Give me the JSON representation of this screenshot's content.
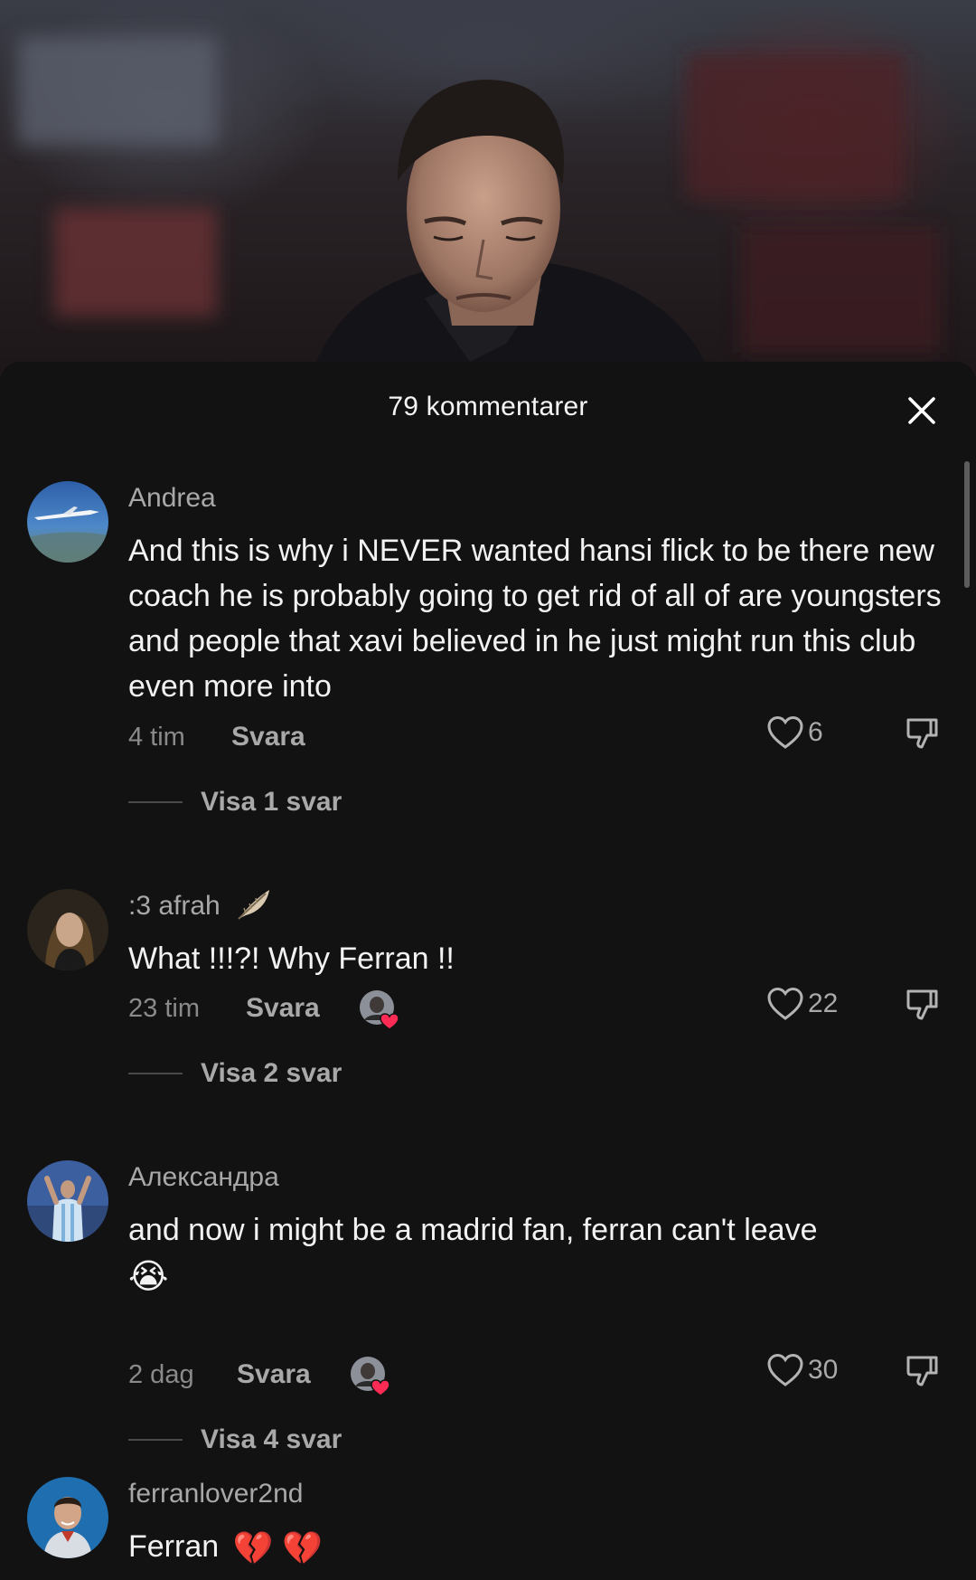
{
  "header": {
    "title": "79 kommentarer",
    "close_icon": "close-icon"
  },
  "comments": [
    {
      "username": "Andrea",
      "text": "And this is why i NEVER wanted hansi flick to be there new coach he is probably going to get rid of all of are youngsters and people that xavi believed in he just might run this club even more into",
      "time": "4 tim",
      "reply_label": "Svara",
      "likes": "6",
      "view_replies": "Visa 1 svar",
      "creator_liked": false
    },
    {
      "username": ":3 afrah",
      "username_emoji": "feather",
      "text": "What !!!?! Why Ferran !!",
      "time": "23 tim",
      "reply_label": "Svara",
      "likes": "22",
      "view_replies": "Visa 2 svar",
      "creator_liked": true
    },
    {
      "username": "Александра",
      "text": "and now i might be a madrid fan, ferran can't leave",
      "text_emoji": "😭",
      "time": "2 dag",
      "reply_label": "Svara",
      "likes": "30",
      "view_replies": "Visa 4 svar",
      "creator_liked": true
    },
    {
      "username": "ferranlover2nd",
      "text": "Ferran",
      "text_emoji": "💔 💔"
    }
  ],
  "colors": {
    "background": "#121212",
    "text_primary": "#f2f2f2",
    "text_secondary": "#a8a8a8",
    "heart_badge": "#fe2c55"
  }
}
